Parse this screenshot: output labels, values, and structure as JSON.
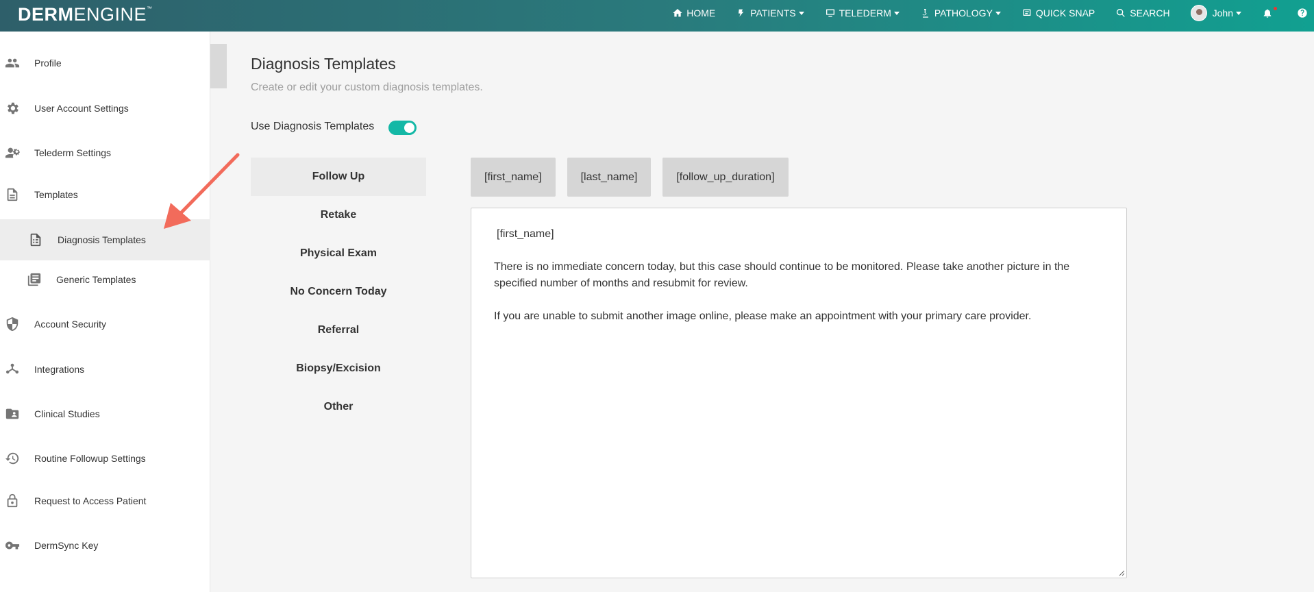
{
  "brand": {
    "part1": "DERM",
    "part2": "ENGINE",
    "tm": "™"
  },
  "nav": {
    "home": "HOME",
    "patients": "PATIENTS",
    "telederm": "TELEDERM",
    "pathology": "PATHOLOGY",
    "quick_snap": "QUICK SNAP",
    "search": "SEARCH",
    "user": "John"
  },
  "sidebar": {
    "items": [
      {
        "label": "Profile"
      },
      {
        "label": "User Account Settings"
      },
      {
        "label": "Telederm Settings"
      },
      {
        "label": "Templates"
      },
      {
        "label": "Diagnosis Templates"
      },
      {
        "label": "Generic Templates"
      },
      {
        "label": "Account Security"
      },
      {
        "label": "Integrations"
      },
      {
        "label": "Clinical Studies"
      },
      {
        "label": "Routine Followup Settings"
      },
      {
        "label": "Request to Access Patient"
      },
      {
        "label": "DermSync Key"
      }
    ]
  },
  "main": {
    "title": "Diagnosis Templates",
    "subtitle": "Create or edit your custom diagnosis templates.",
    "toggle_label": "Use Diagnosis Templates",
    "toggle_on": true,
    "templates": [
      {
        "label": "Follow Up"
      },
      {
        "label": "Retake"
      },
      {
        "label": "Physical Exam"
      },
      {
        "label": "No Concern Today"
      },
      {
        "label": "Referral"
      },
      {
        "label": "Biopsy/Excision"
      },
      {
        "label": "Other"
      }
    ],
    "placeholders": [
      {
        "label": "[first_name]"
      },
      {
        "label": "[last_name]"
      },
      {
        "label": "[follow_up_duration]"
      }
    ],
    "editor": {
      "line1": "[first_name]",
      "para1": "There is no immediate concern today, but this case should continue to be monitored. Please take another picture in the specified number of months and resubmit for review.",
      "para2": "If you are unable to submit another image online, please make an appointment with your primary care provider."
    }
  },
  "colors": {
    "accent": "#14b8a6",
    "arrow": "#f26b5b"
  }
}
